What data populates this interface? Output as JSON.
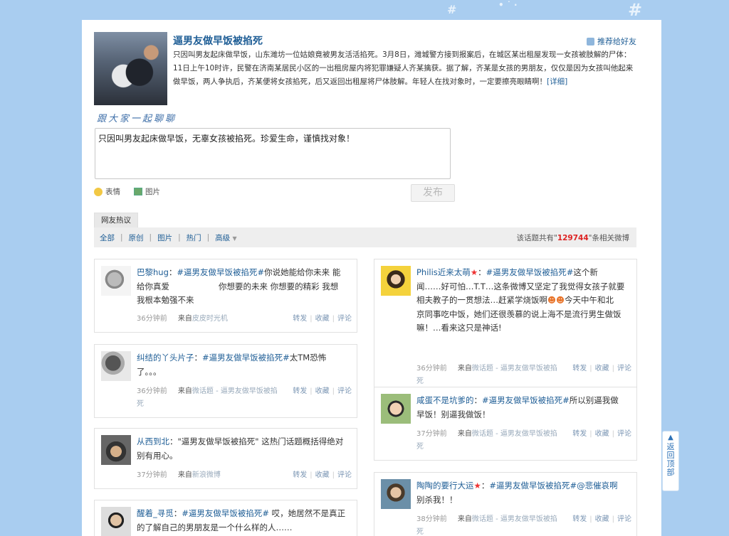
{
  "news": {
    "title": "逼男友做早饭被掐死",
    "recommend_label": "推荐给好友",
    "summary": "只因叫男友起床做早饭，山东潍坊一位姑娘竟被男友活活掐死。3月8日，潍城警方接到报案后，在城区某出租屋发现一女孩被肢解的尸体：11日上午10时许，民警在济南某居民小区的一出租房屋内将犯罪嫌疑人齐某擒获。据了解，齐某是女孩的男朋友，仅仅是因为女孩叫他起来做早饭，两人争执后，齐某便将女孩掐死，后又返回出租屋将尸体肢解。年轻人在找对象时，一定要擦亮眼睛啊！",
    "detail_link": "[详细]"
  },
  "composer": {
    "heading": "跟大家一起聊聊",
    "text": "只因叫男友起床做早饭，无辜女孩被掐死。珍爱生命，谨慎找对象！",
    "emoji_label": "表情",
    "image_label": "图片",
    "post_label": "发布"
  },
  "feed": {
    "tab": "网友热议",
    "filters": [
      "全部",
      "原创",
      "图片",
      "热门",
      "高级"
    ],
    "count_prefix": "该话题共有\"",
    "count": "129744",
    "count_suffix": "\"条相关微博"
  },
  "actions": {
    "forward": "转发",
    "favorite": "收藏",
    "comment": "评论",
    "from": "来自"
  },
  "posts_left": [
    {
      "user": "巴黎hug",
      "tag": "#逼男友做早饭被掐死#",
      "line1": "你说她能给你未来 能",
      "line2": "给你真爱　　　　　　你想要的未来 你想要的精彩 我想",
      "line3": "我根本勉强不来",
      "time": "36分钟前",
      "source": "皮皮时光机"
    },
    {
      "user": "纠结的丫头片子",
      "tag": "#逼男友做早饭被掐死#",
      "line1": "太TM恐怖",
      "line2": "了。。。",
      "time": "36分钟前",
      "source": "微话题 - 逼男友做早饭被掐",
      "source_tail": "死"
    },
    {
      "user": "从西到北",
      "line1": "\"逼男友做早饭被掐死\" 这热门话题概括得绝对",
      "line2": "别有用心。",
      "time": "37分钟前",
      "source": "新浪微博"
    },
    {
      "user": "醒着_寻觅",
      "tag": "#逼男友做早饭被掐死#",
      "line1": " 哎，她居然不是真正",
      "line2": "的了解自己的男朋友是一个什么样的人……"
    }
  ],
  "posts_right": [
    {
      "user": "Philis近来太萌",
      "tag": "#逼男友做早饭被掐死#",
      "line1": "这个新",
      "line2": "闻……好可怕…T.T…这条微博又坚定了我觉得女孩子就要",
      "line3": "相夫教子的一贯想法…赶紧学烧饭啊",
      "line3b": "今天中午和北",
      "line4": "京同事吃中饭，她们还很羡慕的说上海不是流行男生做饭",
      "line5": "嘛！…看来这只是神话!",
      "time": "36分钟前",
      "source": "微话题 - 逼男友做早饭被掐",
      "source_tail": "死"
    },
    {
      "user": "咸蛋不是坑爹的",
      "tag": "#逼男友做早饭被掐死#",
      "line1": "所以别逼我做",
      "line2": "早饭！别逼我做饭！",
      "time": "37分钟前",
      "source": "微话题 - 逼男友做早饭被掐",
      "source_tail": "死"
    },
    {
      "user": "陶陶的要行大运",
      "tag": "#逼男友做早饭被掐死#",
      "tag2": "@悲催哀啊",
      "line2": "别杀我！！",
      "time": "38分钟前",
      "source": "微话题 - 逼男友做早饭被掐",
      "source_tail": "死"
    }
  ],
  "back_to_top": [
    "返",
    "回",
    "顶",
    "部"
  ]
}
